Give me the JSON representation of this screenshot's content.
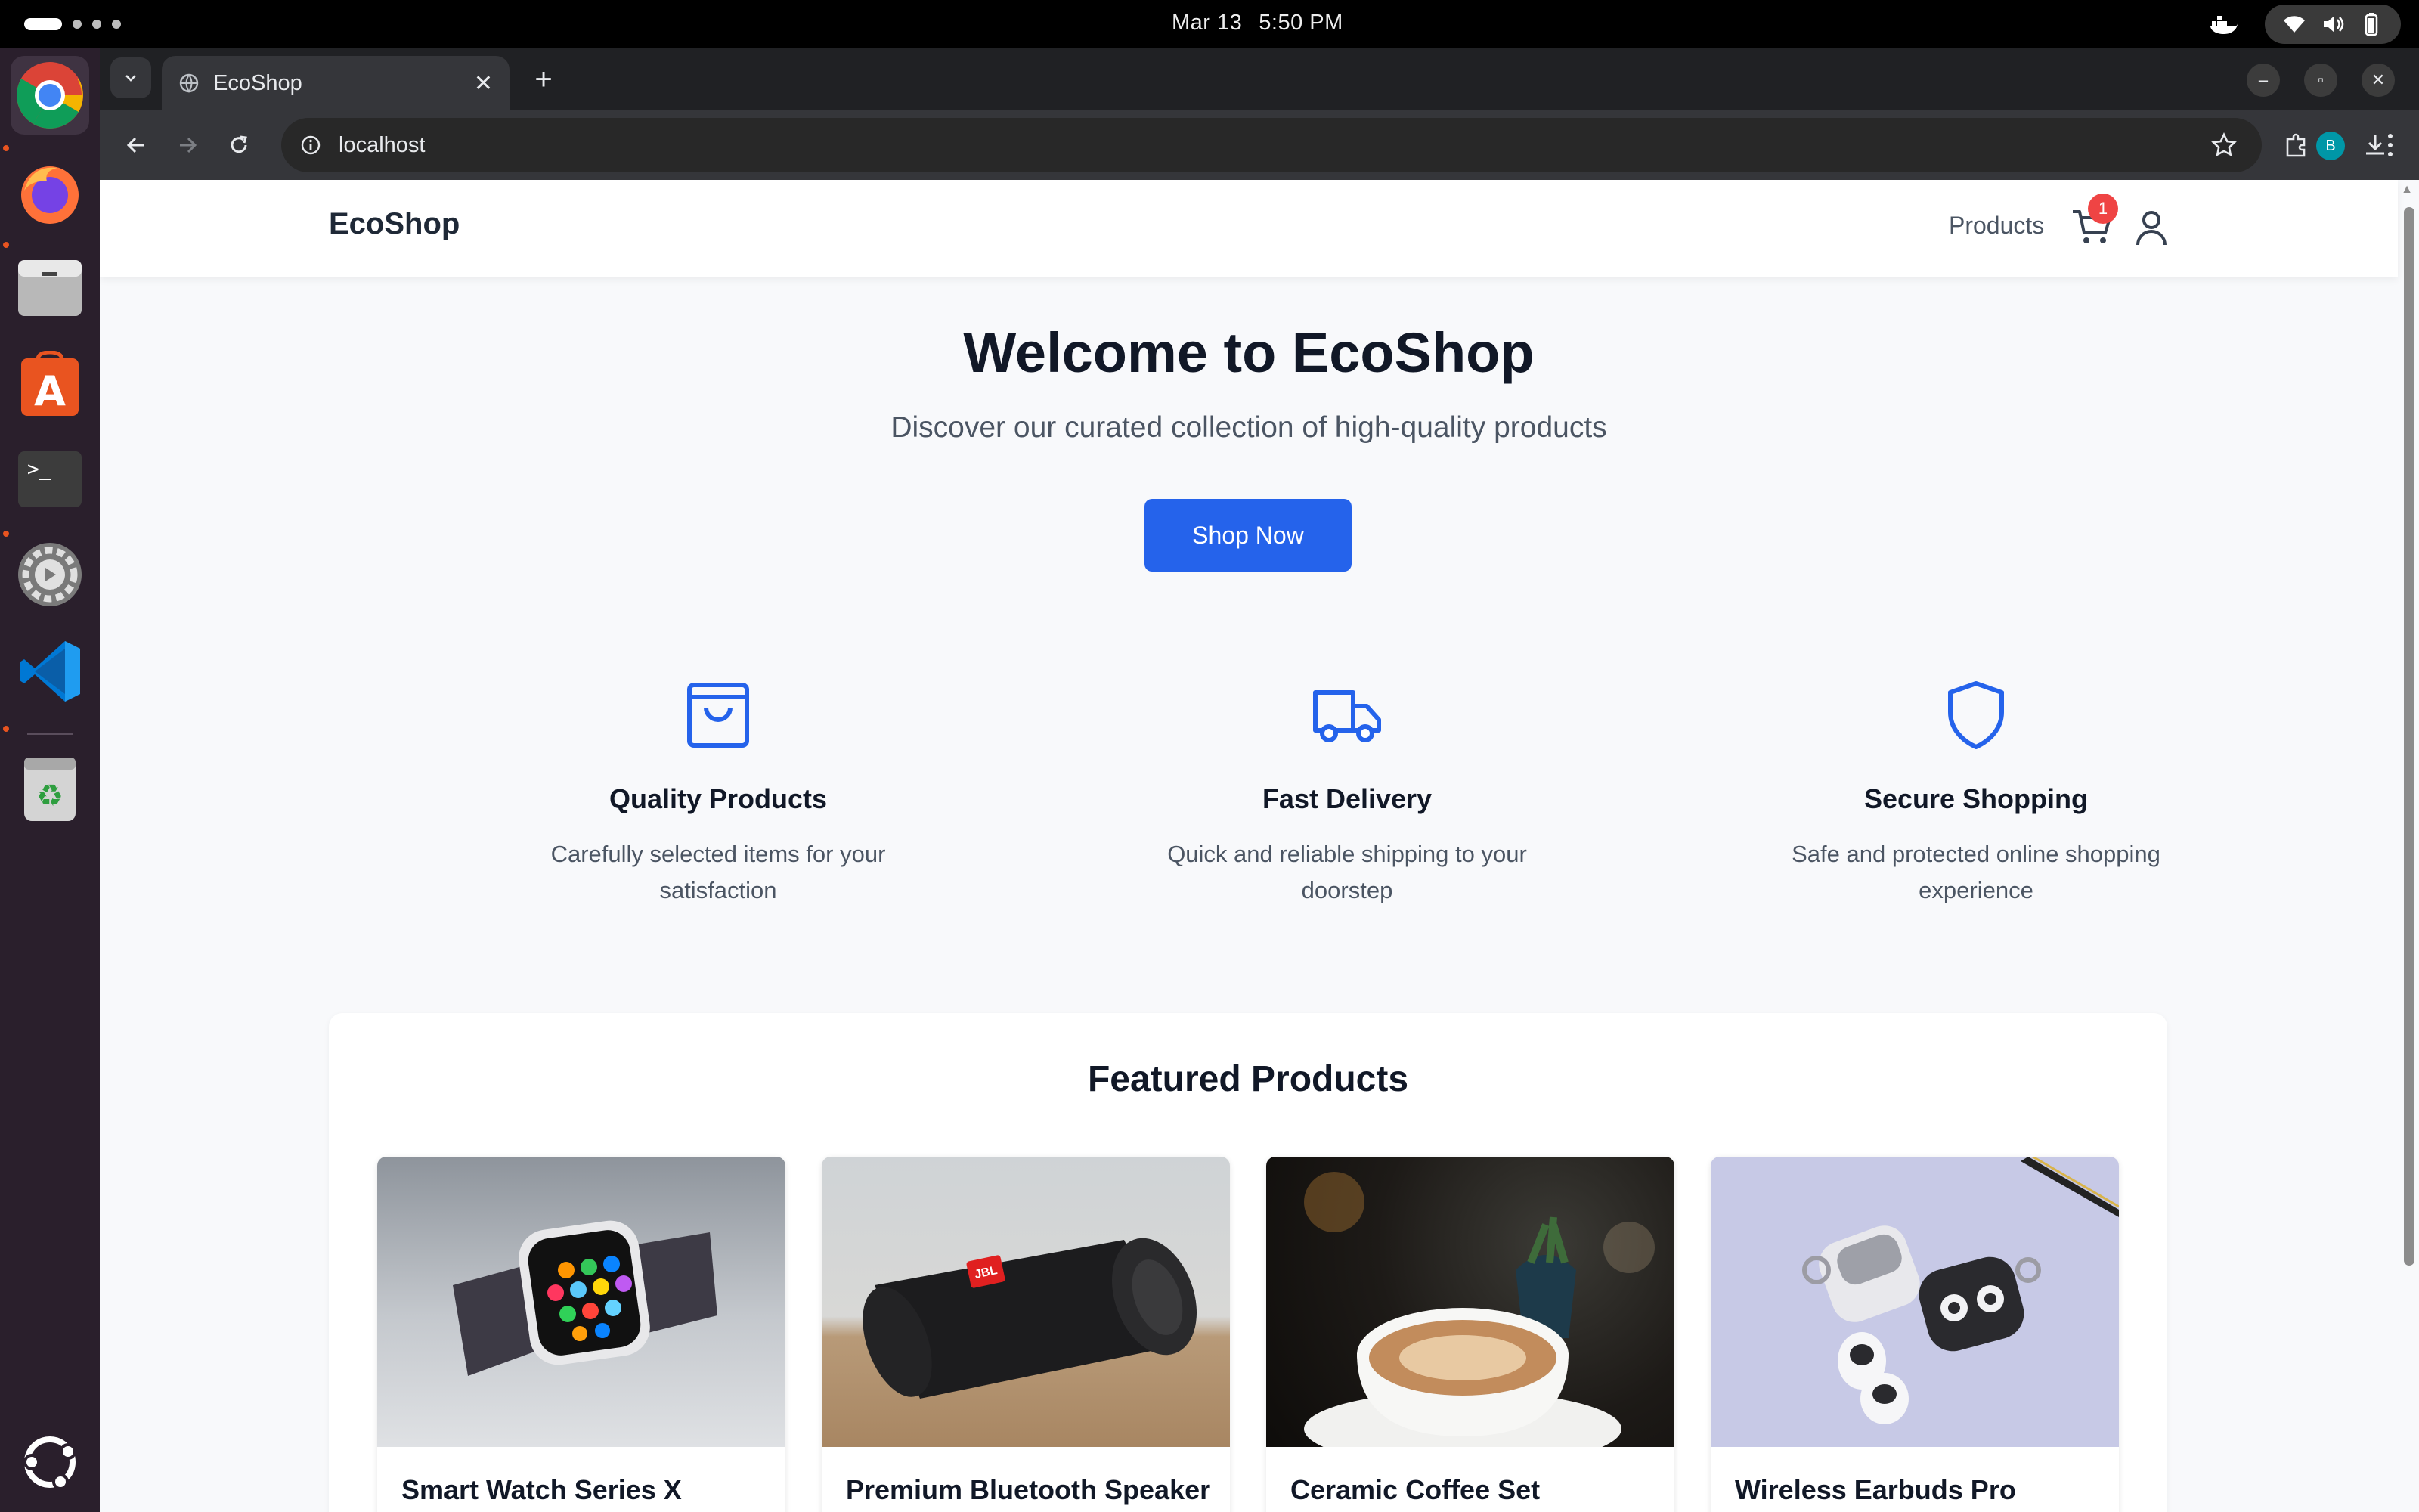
{
  "system": {
    "date": "Mar 13",
    "time": "5:50 PM"
  },
  "dock": {
    "apps": [
      "chrome-icon",
      "firefox-icon",
      "files-icon",
      "app-center-icon",
      "terminal-icon",
      "settings-icon",
      "vscode-icon",
      "trash-icon",
      "show-apps-icon"
    ]
  },
  "browser": {
    "tab_title": "EcoShop",
    "url": "localhost",
    "profile_initial": "B"
  },
  "site": {
    "logo": "EcoShop",
    "nav_products": "Products",
    "cart_count": "1"
  },
  "hero": {
    "title": "Welcome to EcoShop",
    "subtitle": "Discover our curated collection of high-quality products",
    "cta": "Shop Now"
  },
  "features": [
    {
      "title": "Quality Products",
      "desc": "Carefully selected items for your satisfaction",
      "icon": "shopping-bag-icon"
    },
    {
      "title": "Fast Delivery",
      "desc": "Quick and reliable shipping to your doorstep",
      "icon": "truck-icon"
    },
    {
      "title": "Secure Shopping",
      "desc": "Safe and protected online shopping experience",
      "icon": "shield-icon"
    }
  ],
  "featured": {
    "title": "Featured Products",
    "products": [
      {
        "name": "Smart Watch Series X"
      },
      {
        "name": "Premium Bluetooth Speaker",
        "brand_mark": "JBL"
      },
      {
        "name": "Ceramic Coffee Set"
      },
      {
        "name": "Wireless Earbuds Pro"
      }
    ]
  },
  "colors": {
    "accent": "#2563eb",
    "badge": "#ef4444",
    "page_bg": "#f8f9fb"
  }
}
